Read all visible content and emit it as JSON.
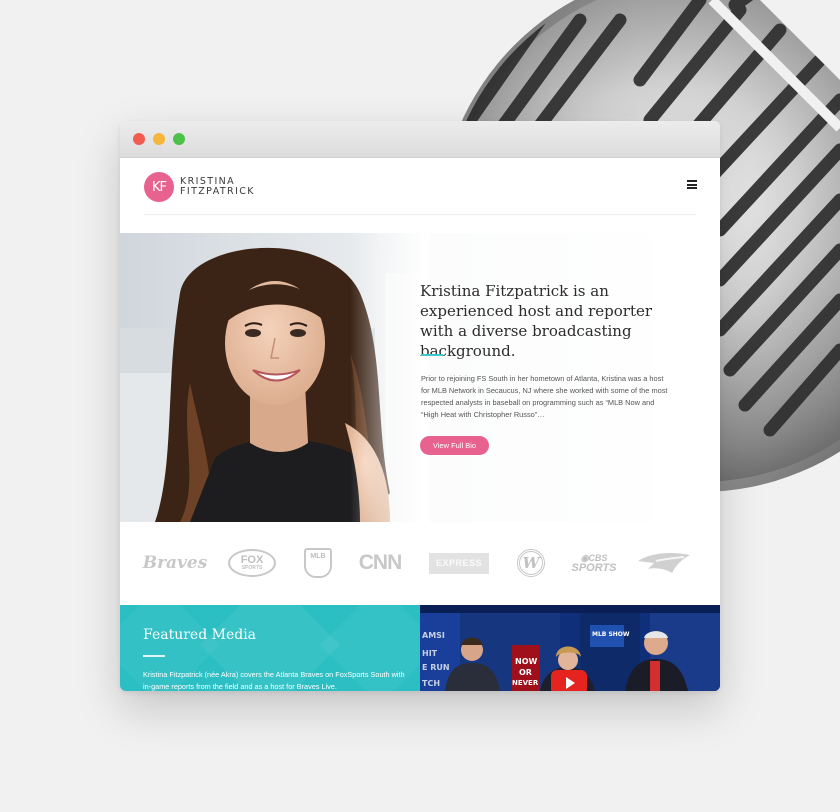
{
  "site": {
    "logo_mark": "KF",
    "logo_line1": "KRISTINA",
    "logo_line2": "FITZPATRICK"
  },
  "hero": {
    "title": "Kristina Fitzpatrick is an experienced host and reporter with a diverse broadcasting background.",
    "body": "Prior to rejoining FS South in her hometown of Atlanta, Kristina was a host for MLB Network in Secaucus, NJ where she worked with some of the most respected analysts in baseball on programming such as “MLB Now and “High Heat with Christopher Russo”…",
    "button_label": "View Full Bio"
  },
  "networks": {
    "braves": "Braves",
    "fox_top": "FOX",
    "fox_bottom": "SPORTS",
    "mlb": "MLB",
    "cnn": "CNN",
    "express": "EXPRESS",
    "nationals": "W",
    "cbs_eye": "◉CBS",
    "cbs_word": "SPORTS"
  },
  "featured": {
    "title": "Featured Media",
    "body": "Kristina Fitzpatrick (née Akra) covers the Atlanta Braves on FoxSports South with in-game reports from the field and as a host for Braves Live."
  },
  "video": {
    "side_text_1": "AMSI",
    "side_text_2": "HIT",
    "side_text_3": "E RUN",
    "side_text_4": "TCH",
    "banner_1": "NOW",
    "banner_2": "OR",
    "banner_3": "NEVER",
    "show_tag": "MLB SHOW"
  },
  "colors": {
    "accent_pink": "#e8628f",
    "accent_teal": "#2bbfc3",
    "youtube_red": "#e52420"
  }
}
